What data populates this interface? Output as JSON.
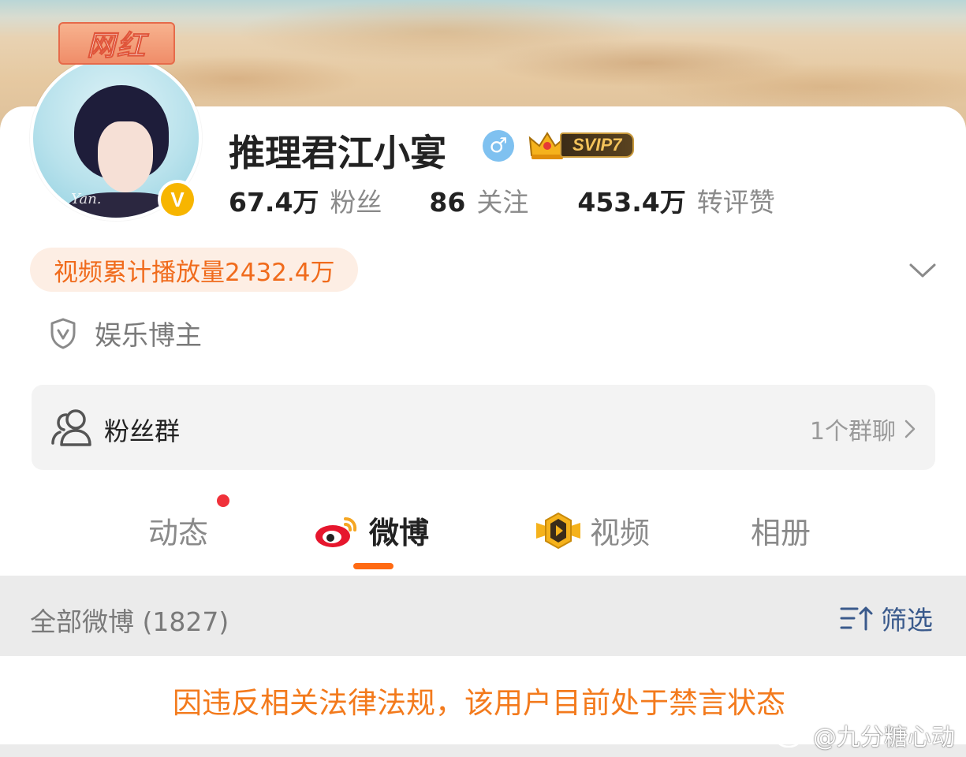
{
  "profile": {
    "badge_label": "网红",
    "name": "推理君江小宴",
    "gender_symbol": "♂",
    "vip_label": "SVIP7",
    "verified_mark": "V",
    "avatar_signature": "Yan.",
    "stats": [
      {
        "value": "67.4万",
        "label": "粉丝"
      },
      {
        "value": "86",
        "label": "关注"
      },
      {
        "value": "453.4万",
        "label": "转评赞"
      }
    ],
    "video_plays": "视频累计播放量2432.4万",
    "verification": "娱乐博主"
  },
  "fan_group": {
    "title": "粉丝群",
    "count": "1个群聊"
  },
  "tabs": [
    {
      "label": "动态",
      "has_dot": true
    },
    {
      "label": "微博",
      "active": true
    },
    {
      "label": "视频"
    },
    {
      "label": "相册"
    }
  ],
  "feed": {
    "all_label": "全部微博 (1827)",
    "filter_label": "筛选",
    "notice": "因违反相关法律法规，该用户目前处于禁言状态"
  },
  "watermark": "@九分糖心动",
  "colors": {
    "accent_orange": "#ff6a13",
    "notice_orange": "#f37a1c",
    "filter_blue": "#3a5a8c",
    "vip_gold": "#f3c25a",
    "verified_yellow": "#f7b500"
  }
}
